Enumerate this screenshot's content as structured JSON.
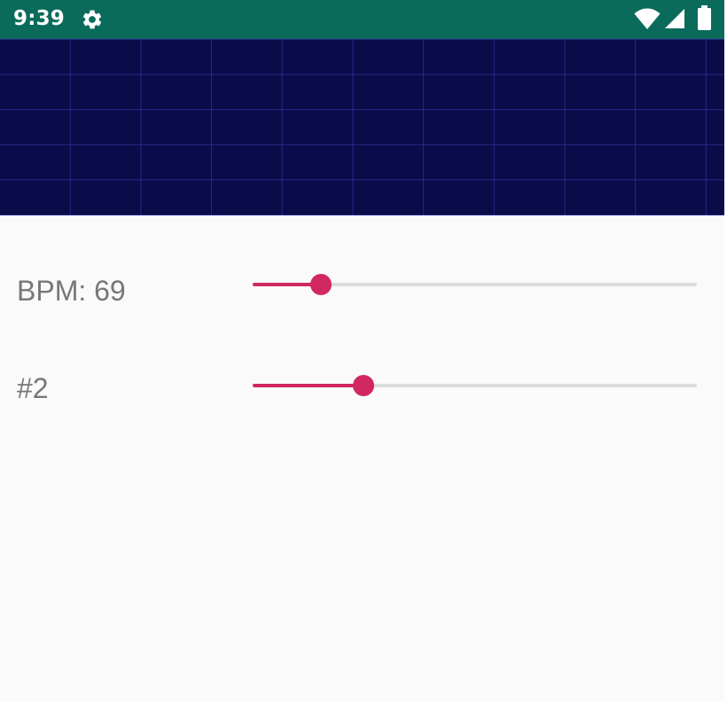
{
  "status_bar": {
    "time": "9:39",
    "background_color": "#0b6b5b",
    "icons": [
      "gear-icon",
      "wifi-icon",
      "signal-icon",
      "battery-icon"
    ]
  },
  "visualizer": {
    "background_color": "#0b0b4a",
    "grid_color": "#3c3cbe"
  },
  "controls": {
    "accent_color": "#d0285f",
    "track_color": "#dcdcdc",
    "bpm": {
      "label": "BPM: 69",
      "value_fraction": 0.154
    },
    "second": {
      "label": "#2",
      "value_fraction": 0.25
    }
  }
}
